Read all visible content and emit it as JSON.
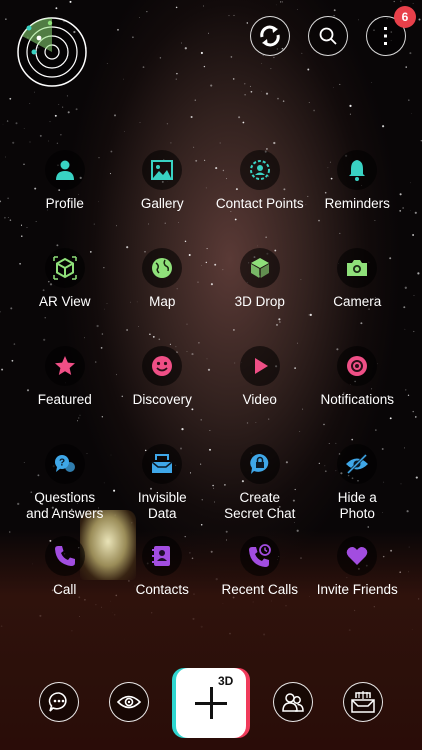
{
  "header": {
    "radar_icon": "radar-icon",
    "sync_icon": "sync-icon",
    "search_icon": "search-icon",
    "menu_icon": "more-vertical-icon",
    "notification_count": "6"
  },
  "grid": {
    "rows": [
      [
        {
          "label": "Profile",
          "icon": "person-icon",
          "color": "#39d2c3"
        },
        {
          "label": "Gallery",
          "icon": "image-icon",
          "color": "#39d2c3"
        },
        {
          "label": "Contact Points",
          "icon": "contact-points-icon",
          "color": "#39d2c3"
        },
        {
          "label": "Reminders",
          "icon": "bell-icon",
          "color": "#39d2c3"
        }
      ],
      [
        {
          "label": "AR View",
          "icon": "ar-cube-icon",
          "color": "#8fe07a"
        },
        {
          "label": "Map",
          "icon": "globe-icon",
          "color": "#8fe07a"
        },
        {
          "label": "3D Drop",
          "icon": "cube-icon",
          "color": "#8fe07a"
        },
        {
          "label": "Camera",
          "icon": "camera-icon",
          "color": "#8fe07a"
        }
      ],
      [
        {
          "label": "Featured",
          "icon": "star-icon",
          "color": "#ef4f86"
        },
        {
          "label": "Discovery",
          "icon": "smiley-icon",
          "color": "#ef4f86"
        },
        {
          "label": "Video",
          "icon": "play-icon",
          "color": "#ef4f86"
        },
        {
          "label": "Notifications",
          "icon": "notification-eye-icon",
          "color": "#ef4f86"
        }
      ],
      [
        {
          "label": "Questions\nand Answers",
          "icon": "question-bubble-icon",
          "color": "#3fa7e8"
        },
        {
          "label": "Invisible\nData",
          "icon": "inbox-icon",
          "color": "#3fa7e8"
        },
        {
          "label": "Create\nSecret Chat",
          "icon": "lock-bubble-icon",
          "color": "#3fa7e8"
        },
        {
          "label": "Hide a\nPhoto",
          "icon": "eye-off-icon",
          "color": "#3fa7e8"
        }
      ],
      [
        {
          "label": "Call",
          "icon": "phone-icon",
          "color": "#a24de0"
        },
        {
          "label": "Contacts",
          "icon": "address-book-icon",
          "color": "#a24de0"
        },
        {
          "label": "Recent Calls",
          "icon": "recent-calls-icon",
          "color": "#a24de0"
        },
        {
          "label": "Invite Friends",
          "icon": "heart-icon",
          "color": "#a24de0"
        }
      ]
    ]
  },
  "bottom_bar": {
    "chat_icon": "chat-bubble-icon",
    "eye_icon": "eye-icon",
    "add_3d_label": "3D",
    "friends_icon": "users-icon",
    "inbox_icon": "inbox-icon"
  },
  "colors": {
    "teal": "#39d2c3",
    "green": "#8fe07a",
    "pink": "#ef4f86",
    "blue": "#3fa7e8",
    "purple": "#a24de0",
    "badge": "#e8404a"
  }
}
